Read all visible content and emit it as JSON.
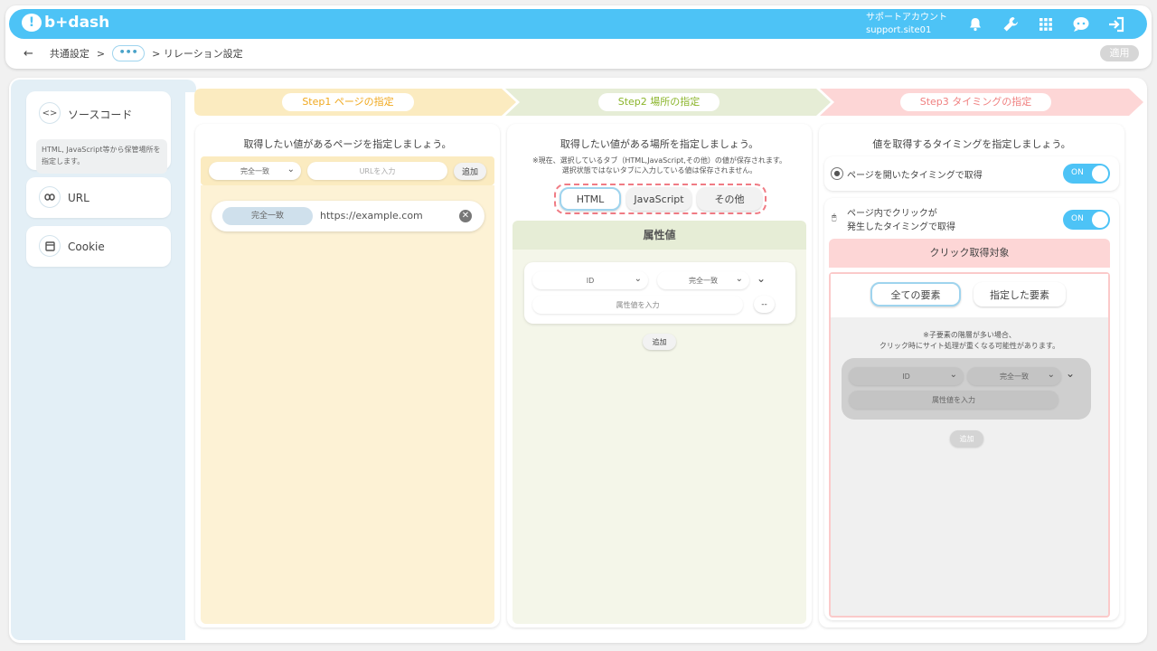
{
  "header": {
    "logo_text": "b+dash",
    "account_label": "サポートアカウント",
    "account_id": "support.site01",
    "icons": [
      "bell-icon",
      "wrench-icon",
      "grid-icon",
      "support-icon",
      "logout-icon"
    ]
  },
  "breadcrumb": {
    "back": "←",
    "root": "共通設定",
    "sep1": ">",
    "more": "•••",
    "current": "> リレーション設定"
  },
  "apply_label": "適用",
  "sidebar": {
    "items": [
      {
        "icon": "code-icon",
        "label": "ソースコード",
        "desc": "HTML, JavaScript等から保管場所を指定します。"
      },
      {
        "icon": "link-icon",
        "label": "URL"
      },
      {
        "icon": "cookie-icon",
        "label": "Cookie"
      }
    ]
  },
  "steps": [
    {
      "label": "Step1 ページの指定",
      "color": "#fbebc0",
      "text_color": "#f0a81e"
    },
    {
      "label": "Step2 場所の指定",
      "color": "#e6edd6",
      "text_color": "#8bb52b"
    },
    {
      "label": "Step3 タイミングの指定",
      "color": "#fdd6d6",
      "text_color": "#f08080"
    }
  ],
  "step1": {
    "heading": "取得したい値があるページを指定しましょう。",
    "match_select": "完全一致",
    "url_placeholder": "URLを入力",
    "add_label": "追加",
    "entry_match": "完全一致",
    "entry_url": "https://example.com"
  },
  "step2": {
    "heading": "取得したい値がある場所を指定しましょう。",
    "note1": "※現在、選択しているタブ（HTML,JavaScript,その他）の値が保存されます。",
    "note2": "選択状態ではないタブに入力している値は保存されません。",
    "tabs": [
      "HTML",
      "JavaScript",
      "その他"
    ],
    "attr_title": "属性値",
    "attr_select": "ID",
    "match_select": "完全一致",
    "attr_placeholder": "属性値を入力",
    "add_label": "追加"
  },
  "step3": {
    "heading": "値を取得するタイミングを指定しましょう。",
    "timing1": "ページを開いたタイミングで取得",
    "timing1_toggle": "ON",
    "timing2_line1": "ページ内でクリックが",
    "timing2_line2": "発生したタイミングで取得",
    "timing2_toggle": "ON",
    "click_title": "クリック取得対象",
    "btn_all": "全ての要素",
    "btn_specified": "指定した要素",
    "note1": "※子要素の階層が多い場合、",
    "note2": "クリック時にサイト処理が重くなる可能性があります。",
    "attr_select": "ID",
    "match_select": "完全一致",
    "attr_placeholder": "属性値を入力",
    "add_label": "追加"
  },
  "colors": {
    "header": "#4dc3f6",
    "step1_bg": "#fdf2d5",
    "step2_bg": "#f4f6e9",
    "step3_bg": "#fdd6d6",
    "highlight": "#f07b84"
  }
}
